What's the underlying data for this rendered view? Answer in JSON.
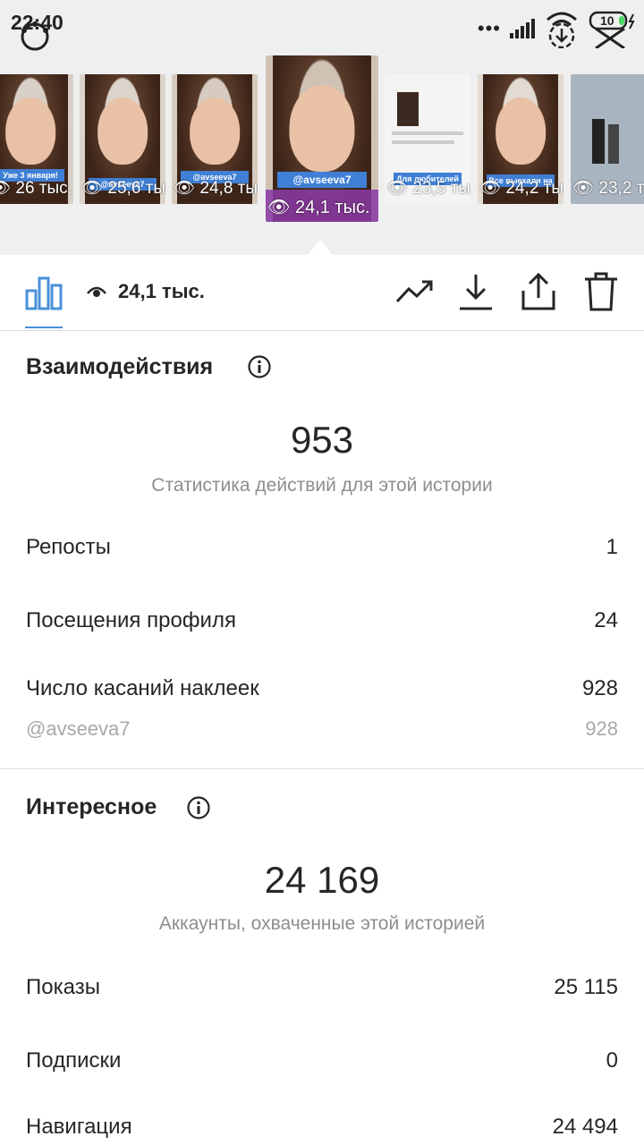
{
  "status_bar": {
    "time": "22:40",
    "battery": "10"
  },
  "story_thumbnails": [
    {
      "views": "26 тыс.",
      "sticker": "Уже 3 января!",
      "active": false
    },
    {
      "views": "25,6 тыс.",
      "sticker": "@avseeva7",
      "active": false
    },
    {
      "views": "24,8 тыс.",
      "sticker": "@avseeva7",
      "active": false
    },
    {
      "views": "24,1 тыс.",
      "sticker": "@avseeva7",
      "active": true
    },
    {
      "views": "23,5 тыс.",
      "sticker": "Для любителей",
      "active": false
    },
    {
      "views": "24,2 тыс.",
      "sticker": "Все выехали на",
      "active": false
    },
    {
      "views": "23,2 тыс.",
      "sticker": "",
      "active": false
    }
  ],
  "toolbar": {
    "views_count": "24,1 тыс.",
    "icons": [
      "bar-chart-icon",
      "eye-icon",
      "trend-icon",
      "download-icon",
      "share-icon",
      "trash-icon"
    ],
    "accent": "#4a90d9"
  },
  "interactions": {
    "title": "Взаимодействия",
    "total": "953",
    "total_caption": "Статистика действий для этой истории",
    "rows": [
      {
        "label": "Репосты",
        "value": "1"
      },
      {
        "label": "Посещения профиля",
        "value": "24"
      },
      {
        "label": "Число касаний наклеек",
        "value": "928"
      }
    ],
    "sub_row": {
      "label": "@avseeva7",
      "value": "928"
    }
  },
  "discovery": {
    "title": "Интересное",
    "total": "24 169",
    "total_caption": "Аккаунты, охваченные этой историей",
    "rows": [
      {
        "label": "Показы",
        "value": "25 115"
      },
      {
        "label": "Подписки",
        "value": "0"
      },
      {
        "label": "Навигация",
        "value": "24 494"
      }
    ]
  }
}
